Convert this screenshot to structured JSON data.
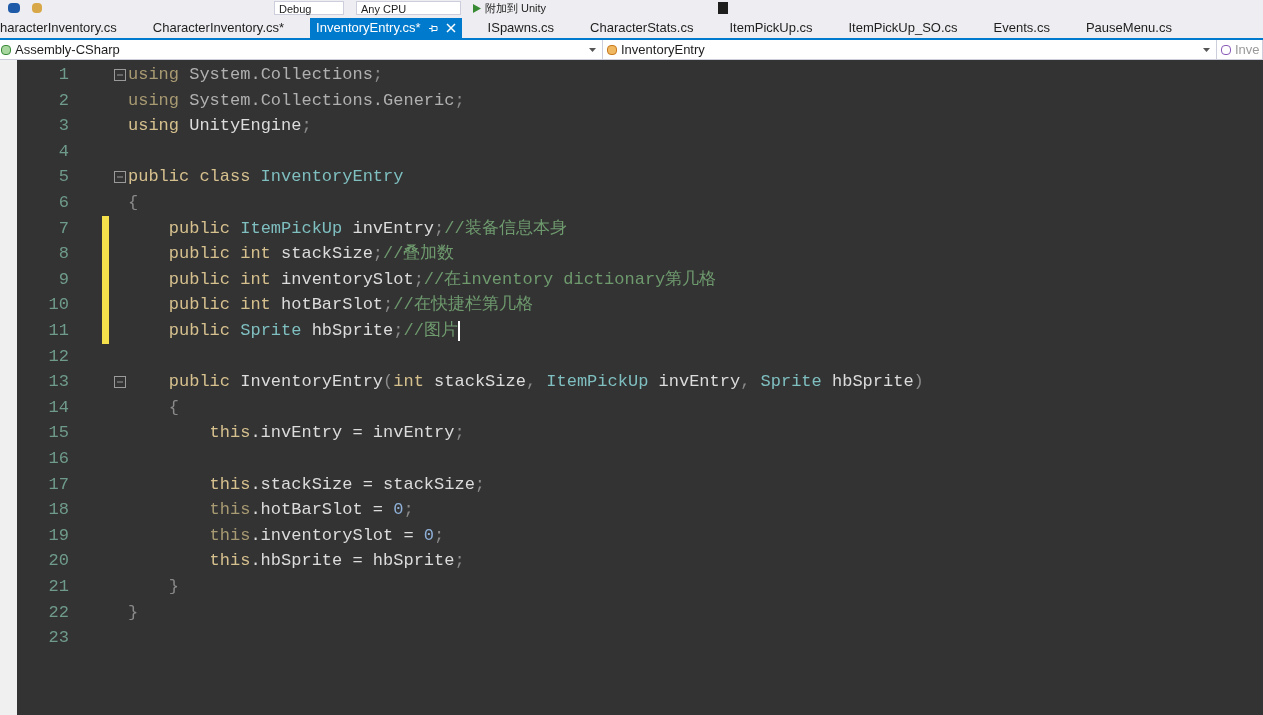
{
  "toolbar": {
    "configuration": "Debug",
    "platform": "Any CPU",
    "run_button": "附加到 Unity"
  },
  "tabs": [
    {
      "label": "haracterInventory.cs",
      "selected": false
    },
    {
      "label": "CharacterInventory.cs*",
      "selected": false
    },
    {
      "label": "InventoryEntry.cs*",
      "selected": true
    },
    {
      "label": "ISpawns.cs",
      "selected": false
    },
    {
      "label": "CharacterStats.cs",
      "selected": false
    },
    {
      "label": "ItemPickUp.cs",
      "selected": false
    },
    {
      "label": "ItemPickUp_SO.cs",
      "selected": false
    },
    {
      "label": "Events.cs",
      "selected": false
    },
    {
      "label": "PauseMenu.cs",
      "selected": false
    }
  ],
  "navigation": {
    "project": "Assembly-CSharp",
    "type": "InventoryEntry",
    "member": "Inve"
  },
  "code": [
    {
      "number": "1",
      "fold": true,
      "tokens": [
        {
          "kind": "keyword_faded",
          "text": "using"
        },
        {
          "kind": "ident_faded",
          "text": " System.Collections"
        },
        {
          "kind": "punct",
          "text": ";"
        }
      ]
    },
    {
      "number": "2",
      "tokens": [
        {
          "kind": "keyword_faded",
          "text": "using"
        },
        {
          "kind": "ident_faded",
          "text": " System.Collections.Generic"
        },
        {
          "kind": "punct",
          "text": ";"
        }
      ]
    },
    {
      "number": "3",
      "tokens": [
        {
          "kind": "keyword",
          "text": "using"
        },
        {
          "kind": "ident",
          "text": " UnityEngine"
        },
        {
          "kind": "punct",
          "text": ";"
        }
      ]
    },
    {
      "number": "4"
    },
    {
      "number": "5",
      "fold": true,
      "tokens": [
        {
          "kind": "keyword",
          "text": "public class"
        },
        {
          "kind": "type",
          "text": " InventoryEntry"
        }
      ]
    },
    {
      "number": "6",
      "tokens": [
        {
          "kind": "punct",
          "text": "{"
        }
      ]
    },
    {
      "number": "7",
      "changed": true,
      "tokens": [
        {
          "kind": "keyword",
          "text": "    public"
        },
        {
          "kind": "type",
          "text": " ItemPickUp"
        },
        {
          "kind": "ident",
          "text": " invEntry"
        },
        {
          "kind": "punct",
          "text": ";"
        },
        {
          "kind": "comment",
          "text": "//装备信息本身"
        }
      ]
    },
    {
      "number": "8",
      "changed": true,
      "tokens": [
        {
          "kind": "keyword",
          "text": "    public int"
        },
        {
          "kind": "ident",
          "text": " stackSize"
        },
        {
          "kind": "punct",
          "text": ";"
        },
        {
          "kind": "comment",
          "text": "//叠加数"
        }
      ]
    },
    {
      "number": "9",
      "changed": true,
      "tokens": [
        {
          "kind": "keyword",
          "text": "    public int"
        },
        {
          "kind": "ident",
          "text": " inventorySlot"
        },
        {
          "kind": "punct",
          "text": ";"
        },
        {
          "kind": "comment",
          "text": "//在inventory dictionary第几格"
        }
      ]
    },
    {
      "number": "10",
      "changed": true,
      "tokens": [
        {
          "kind": "keyword",
          "text": "    public int"
        },
        {
          "kind": "ident",
          "text": " hotBarSlot"
        },
        {
          "kind": "punct",
          "text": ";"
        },
        {
          "kind": "comment",
          "text": "//在快捷栏第几格"
        }
      ]
    },
    {
      "number": "11",
      "changed": true,
      "caret": true,
      "tokens": [
        {
          "kind": "keyword",
          "text": "    public"
        },
        {
          "kind": "type",
          "text": " Sprite"
        },
        {
          "kind": "ident",
          "text": " hbSprite"
        },
        {
          "kind": "punct",
          "text": ";"
        },
        {
          "kind": "comment",
          "text": "//图片"
        }
      ]
    },
    {
      "number": "12"
    },
    {
      "number": "13",
      "fold": true,
      "tokens": [
        {
          "kind": "keyword",
          "text": "    public"
        },
        {
          "kind": "ident",
          "text": " InventoryEntry"
        },
        {
          "kind": "punct",
          "text": "("
        },
        {
          "kind": "keyword",
          "text": "int"
        },
        {
          "kind": "ident",
          "text": " stackSize"
        },
        {
          "kind": "punct",
          "text": ","
        },
        {
          "kind": "type",
          "text": " ItemPickUp"
        },
        {
          "kind": "ident",
          "text": " invEntry"
        },
        {
          "kind": "punct",
          "text": ","
        },
        {
          "kind": "type",
          "text": " Sprite"
        },
        {
          "kind": "ident",
          "text": " hbSprite"
        },
        {
          "kind": "punct",
          "text": ")"
        }
      ]
    },
    {
      "number": "14",
      "tokens": [
        {
          "kind": "punct",
          "text": "    {"
        }
      ]
    },
    {
      "number": "15",
      "tokens": [
        {
          "kind": "keyword",
          "text": "        this"
        },
        {
          "kind": "ident",
          "text": ".invEntry = invEntry"
        },
        {
          "kind": "punct",
          "text": ";"
        }
      ]
    },
    {
      "number": "16"
    },
    {
      "number": "17",
      "tokens": [
        {
          "kind": "keyword",
          "text": "        this"
        },
        {
          "kind": "ident",
          "text": ".stackSize = stackSize"
        },
        {
          "kind": "punct",
          "text": ";"
        }
      ]
    },
    {
      "number": "18",
      "tokens": [
        {
          "kind": "keyword_faded",
          "text": "        this"
        },
        {
          "kind": "ident",
          "text": ".hotBarSlot = "
        },
        {
          "kind": "number",
          "text": "0"
        },
        {
          "kind": "punct",
          "text": ";"
        }
      ]
    },
    {
      "number": "19",
      "tokens": [
        {
          "kind": "keyword_faded",
          "text": "        this"
        },
        {
          "kind": "ident",
          "text": ".inventorySlot = "
        },
        {
          "kind": "number",
          "text": "0"
        },
        {
          "kind": "punct",
          "text": ";"
        }
      ]
    },
    {
      "number": "20",
      "tokens": [
        {
          "kind": "keyword",
          "text": "        this"
        },
        {
          "kind": "ident",
          "text": ".hbSprite = hbSprite"
        },
        {
          "kind": "punct",
          "text": ";"
        }
      ]
    },
    {
      "number": "21",
      "tokens": [
        {
          "kind": "punct",
          "text": "    }"
        }
      ]
    },
    {
      "number": "22",
      "tokens": [
        {
          "kind": "punct",
          "text": "}"
        }
      ]
    },
    {
      "number": "23"
    }
  ]
}
